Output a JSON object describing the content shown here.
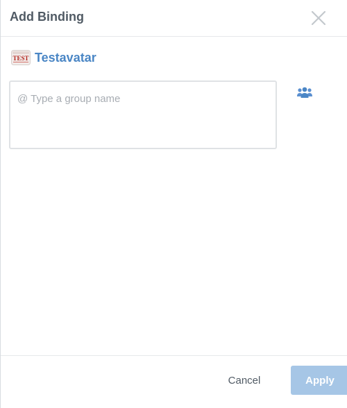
{
  "dialog": {
    "title": "Add Binding",
    "close_icon": "close-icon"
  },
  "subject": {
    "avatar_icon": "test-avatar-image",
    "name": "Testavatar",
    "name_color": "#4a86c5"
  },
  "group_input": {
    "placeholder": "@ Type a group name",
    "value": ""
  },
  "group_picker_icon": "users-group-icon",
  "footer": {
    "cancel_label": "Cancel",
    "apply_label": "Apply",
    "apply_color": "#a6c6e6",
    "apply_disabled": true
  }
}
